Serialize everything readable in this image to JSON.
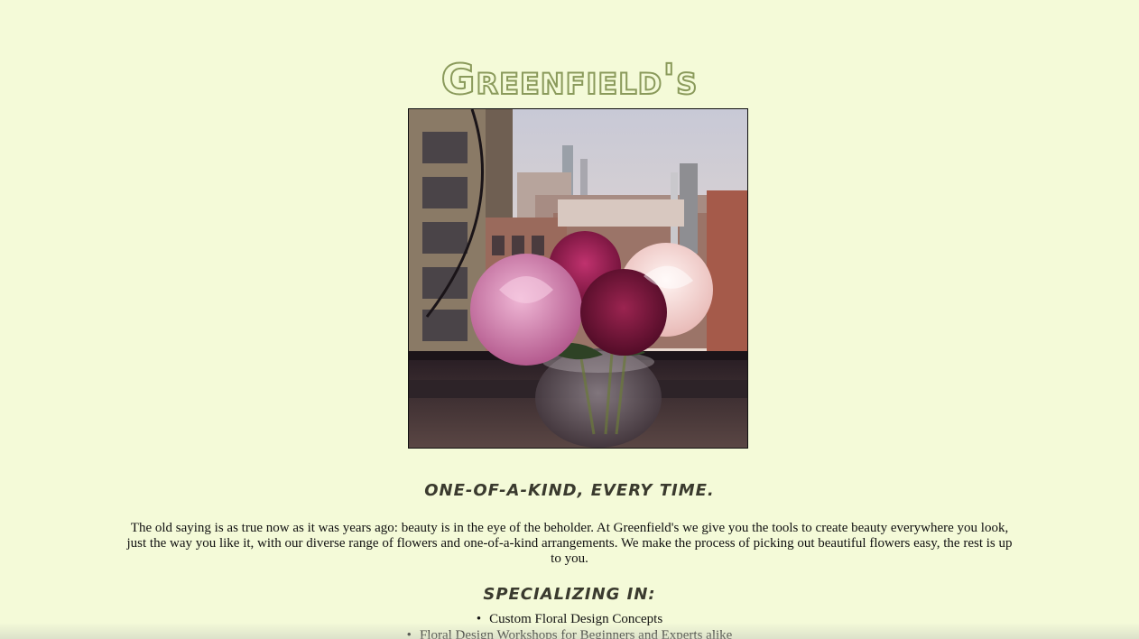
{
  "site": {
    "brand": "Greenfield's"
  },
  "hero": {
    "image_alt": "Peonies in a glass bowl vase on a city window sill"
  },
  "tagline": "One-of-a-kind, every time.",
  "intro": {
    "text": "The old saying is as true now as it was years ago: beauty is in the eye of the beholder. At Greenfield's we give you the tools to create beauty everywhere you look, just the way you like it, with our diverse range of flowers and one-of-a-kind arrangements. We make the process of picking out beautiful flowers easy, the rest is up to you."
  },
  "specializing": {
    "heading": "Specializing in:",
    "items": [
      "Custom Floral Design Concepts",
      "Floral Design Workshops for Beginners and Experts alike"
    ]
  },
  "colors": {
    "background": "#f4fad8",
    "brand_stroke": "#8a9a5b",
    "heading": "#3a3a2e"
  }
}
